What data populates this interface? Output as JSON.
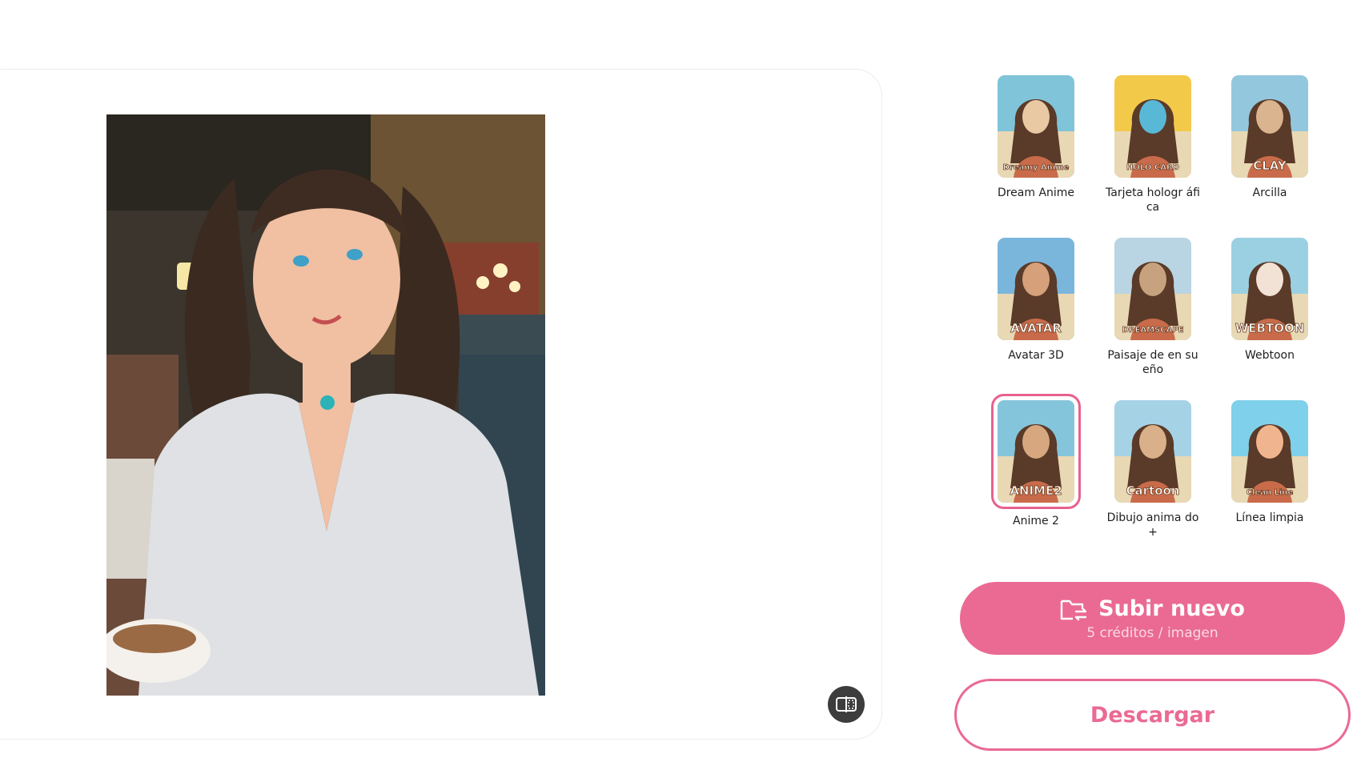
{
  "preview": {
    "compare_icon": "compare-split-icon"
  },
  "styles": [
    {
      "label": "Dream Anime",
      "thumb_text": "Dreamy Anime",
      "colors": [
        "#7fc4d8",
        "#e9c9a3"
      ],
      "selected": false
    },
    {
      "label": "Tarjeta hologr áfica",
      "thumb_text": "HOLO CARD",
      "colors": [
        "#f3c94a",
        "#58b8d6"
      ],
      "selected": false
    },
    {
      "label": "Arcilla",
      "thumb_text": "CLAY",
      "colors": [
        "#93c7de",
        "#d9b48e"
      ],
      "selected": false
    },
    {
      "label": "Avatar 3D",
      "thumb_text": "AVATAR",
      "colors": [
        "#7ab6dc",
        "#d5a07a"
      ],
      "selected": false
    },
    {
      "label": "Paisaje de en sueño",
      "thumb_text": "DREAMSCAPE",
      "colors": [
        "#b9d4e2",
        "#c6a27e"
      ],
      "selected": false
    },
    {
      "label": "Webtoon",
      "thumb_text": "WEBTOON",
      "colors": [
        "#9bd0e3",
        "#f2e2d6"
      ],
      "selected": false
    },
    {
      "label": "Anime 2",
      "thumb_text": "ANIME2",
      "colors": [
        "#84c5db",
        "#d7a77f"
      ],
      "selected": true
    },
    {
      "label": "Dibujo anima do+",
      "thumb_text": "Cartoon",
      "colors": [
        "#a6d2e6",
        "#d9b08a"
      ],
      "selected": false
    },
    {
      "label": "Línea limpia",
      "thumb_text": "Clean Line",
      "colors": [
        "#7fd0ea",
        "#f0b58f"
      ],
      "selected": false
    }
  ],
  "actions": {
    "upload_title": "Subir nuevo",
    "upload_subtitle": "5 créditos / imagen",
    "upload_icon": "folder-swap-icon",
    "download_label": "Descargar"
  },
  "colors": {
    "accent": "#ea6a93",
    "compare_button": "#3d3d3d"
  }
}
